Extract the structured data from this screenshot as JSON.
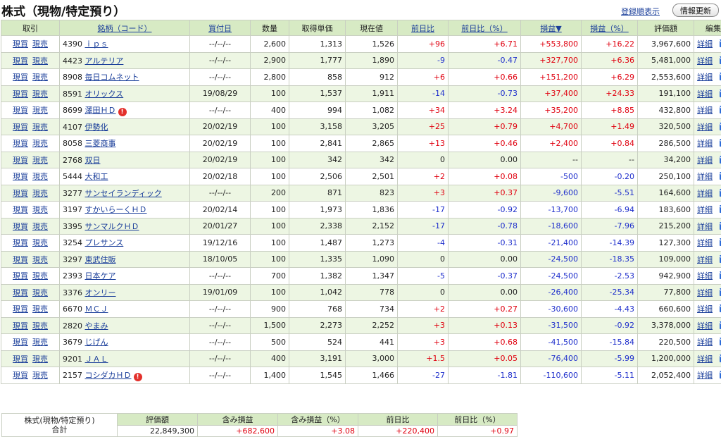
{
  "page": {
    "title": "株式（現物/特定預り）",
    "sort_link": "登録順表示",
    "refresh_button": "情報更新"
  },
  "colors": {
    "header_bg": "#d7eac4",
    "row_alt_bg": "#edf6e3",
    "positive": "#e0000f",
    "negative": "#1f2fcc",
    "link": "#1a3e9a"
  },
  "table": {
    "headers": {
      "torihiki": "取引",
      "meigara": "銘柄（コード）",
      "kaitsukebi": "買付日",
      "suryo": "数量",
      "tanka": "取得単価",
      "genzaine": "現在値",
      "zenjitsuhi": "前日比",
      "zenjitsuhi_pct": "前日比（%）",
      "soneki": "損益▼",
      "soneki_pct": "損益（%）",
      "hyokagaku": "評価額",
      "henshu": "編集"
    },
    "buy_label": "現買",
    "sell_label": "現売",
    "detail_label": "詳細",
    "rows": [
      {
        "code": "4390",
        "name": "ｉｐｓ",
        "date": "--/--/--",
        "qty": "2,600",
        "cost": "1,313",
        "price": "1,526",
        "chg": "+96",
        "chg_pct": "+6.71",
        "pl": "+553,800",
        "pl_pct": "+16.22",
        "value": "3,967,600",
        "warn": false,
        "chg_s": "pos",
        "pct_s": "pos",
        "pl_s": "pos",
        "plp_s": "pos"
      },
      {
        "code": "4423",
        "name": "アルテリア",
        "date": "--/--/--",
        "qty": "2,900",
        "cost": "1,777",
        "price": "1,890",
        "chg": "-9",
        "chg_pct": "-0.47",
        "pl": "+327,700",
        "pl_pct": "+6.36",
        "value": "5,481,000",
        "warn": false,
        "chg_s": "neg",
        "pct_s": "neg",
        "pl_s": "pos",
        "plp_s": "pos"
      },
      {
        "code": "8908",
        "name": "毎日コムネット",
        "date": "--/--/--",
        "qty": "2,800",
        "cost": "858",
        "price": "912",
        "chg": "+6",
        "chg_pct": "+0.66",
        "pl": "+151,200",
        "pl_pct": "+6.29",
        "value": "2,553,600",
        "warn": false,
        "chg_s": "pos",
        "pct_s": "pos",
        "pl_s": "pos",
        "plp_s": "pos"
      },
      {
        "code": "8591",
        "name": "オリックス",
        "date": "19/08/29",
        "qty": "100",
        "cost": "1,537",
        "price": "1,911",
        "chg": "-14",
        "chg_pct": "-0.73",
        "pl": "+37,400",
        "pl_pct": "+24.33",
        "value": "191,100",
        "warn": false,
        "chg_s": "neg",
        "pct_s": "neg",
        "pl_s": "pos",
        "plp_s": "pos"
      },
      {
        "code": "8699",
        "name": "澤田ＨＤ",
        "date": "--/--/--",
        "qty": "400",
        "cost": "994",
        "price": "1,082",
        "chg": "+34",
        "chg_pct": "+3.24",
        "pl": "+35,200",
        "pl_pct": "+8.85",
        "value": "432,800",
        "warn": true,
        "chg_s": "pos",
        "pct_s": "pos",
        "pl_s": "pos",
        "plp_s": "pos"
      },
      {
        "code": "4107",
        "name": "伊勢化",
        "date": "20/02/19",
        "qty": "100",
        "cost": "3,158",
        "price": "3,205",
        "chg": "+25",
        "chg_pct": "+0.79",
        "pl": "+4,700",
        "pl_pct": "+1.49",
        "value": "320,500",
        "warn": false,
        "chg_s": "pos",
        "pct_s": "pos",
        "pl_s": "pos",
        "plp_s": "pos"
      },
      {
        "code": "8058",
        "name": "三菱商事",
        "date": "20/02/19",
        "qty": "100",
        "cost": "2,841",
        "price": "2,865",
        "chg": "+13",
        "chg_pct": "+0.46",
        "pl": "+2,400",
        "pl_pct": "+0.84",
        "value": "286,500",
        "warn": false,
        "chg_s": "pos",
        "pct_s": "pos",
        "pl_s": "pos",
        "plp_s": "pos"
      },
      {
        "code": "2768",
        "name": "双日",
        "date": "20/02/19",
        "qty": "100",
        "cost": "342",
        "price": "342",
        "chg": "0",
        "chg_pct": "0.00",
        "pl": "--",
        "pl_pct": "--",
        "value": "34,200",
        "warn": false,
        "chg_s": "",
        "pct_s": "",
        "pl_s": "",
        "plp_s": ""
      },
      {
        "code": "5444",
        "name": "大和工",
        "date": "20/02/18",
        "qty": "100",
        "cost": "2,506",
        "price": "2,501",
        "chg": "+2",
        "chg_pct": "+0.08",
        "pl": "-500",
        "pl_pct": "-0.20",
        "value": "250,100",
        "warn": false,
        "chg_s": "pos",
        "pct_s": "pos",
        "pl_s": "neg",
        "plp_s": "neg"
      },
      {
        "code": "3277",
        "name": "サンセイランディック",
        "date": "--/--/--",
        "qty": "200",
        "cost": "871",
        "price": "823",
        "chg": "+3",
        "chg_pct": "+0.37",
        "pl": "-9,600",
        "pl_pct": "-5.51",
        "value": "164,600",
        "warn": false,
        "chg_s": "pos",
        "pct_s": "pos",
        "pl_s": "neg",
        "plp_s": "neg"
      },
      {
        "code": "3197",
        "name": "すかいらーくＨＤ",
        "date": "20/02/14",
        "qty": "100",
        "cost": "1,973",
        "price": "1,836",
        "chg": "-17",
        "chg_pct": "-0.92",
        "pl": "-13,700",
        "pl_pct": "-6.94",
        "value": "183,600",
        "warn": false,
        "chg_s": "neg",
        "pct_s": "neg",
        "pl_s": "neg",
        "plp_s": "neg"
      },
      {
        "code": "3395",
        "name": "サンマルクＨＤ",
        "date": "20/01/27",
        "qty": "100",
        "cost": "2,338",
        "price": "2,152",
        "chg": "-17",
        "chg_pct": "-0.78",
        "pl": "-18,600",
        "pl_pct": "-7.96",
        "value": "215,200",
        "warn": false,
        "chg_s": "neg",
        "pct_s": "neg",
        "pl_s": "neg",
        "plp_s": "neg"
      },
      {
        "code": "3254",
        "name": "プレサンス",
        "date": "19/12/16",
        "qty": "100",
        "cost": "1,487",
        "price": "1,273",
        "chg": "-4",
        "chg_pct": "-0.31",
        "pl": "-21,400",
        "pl_pct": "-14.39",
        "value": "127,300",
        "warn": false,
        "chg_s": "neg",
        "pct_s": "neg",
        "pl_s": "neg",
        "plp_s": "neg"
      },
      {
        "code": "3297",
        "name": "東武住販",
        "date": "18/10/05",
        "qty": "100",
        "cost": "1,335",
        "price": "1,090",
        "chg": "0",
        "chg_pct": "0.00",
        "pl": "-24,500",
        "pl_pct": "-18.35",
        "value": "109,000",
        "warn": false,
        "chg_s": "",
        "pct_s": "",
        "pl_s": "neg",
        "plp_s": "neg"
      },
      {
        "code": "2393",
        "name": "日本ケア",
        "date": "--/--/--",
        "qty": "700",
        "cost": "1,382",
        "price": "1,347",
        "chg": "-5",
        "chg_pct": "-0.37",
        "pl": "-24,500",
        "pl_pct": "-2.53",
        "value": "942,900",
        "warn": false,
        "chg_s": "neg",
        "pct_s": "neg",
        "pl_s": "neg",
        "plp_s": "neg"
      },
      {
        "code": "3376",
        "name": "オンリー",
        "date": "19/01/09",
        "qty": "100",
        "cost": "1,042",
        "price": "778",
        "chg": "0",
        "chg_pct": "0.00",
        "pl": "-26,400",
        "pl_pct": "-25.34",
        "value": "77,800",
        "warn": false,
        "chg_s": "",
        "pct_s": "",
        "pl_s": "neg",
        "plp_s": "neg"
      },
      {
        "code": "6670",
        "name": "ＭＣＪ",
        "date": "--/--/--",
        "qty": "900",
        "cost": "768",
        "price": "734",
        "chg": "+2",
        "chg_pct": "+0.27",
        "pl": "-30,600",
        "pl_pct": "-4.43",
        "value": "660,600",
        "warn": false,
        "chg_s": "pos",
        "pct_s": "pos",
        "pl_s": "neg",
        "plp_s": "neg"
      },
      {
        "code": "2820",
        "name": "やまみ",
        "date": "--/--/--",
        "qty": "1,500",
        "cost": "2,273",
        "price": "2,252",
        "chg": "+3",
        "chg_pct": "+0.13",
        "pl": "-31,500",
        "pl_pct": "-0.92",
        "value": "3,378,000",
        "warn": false,
        "chg_s": "pos",
        "pct_s": "pos",
        "pl_s": "neg",
        "plp_s": "neg"
      },
      {
        "code": "3679",
        "name": "じげん",
        "date": "--/--/--",
        "qty": "500",
        "cost": "524",
        "price": "441",
        "chg": "+3",
        "chg_pct": "+0.68",
        "pl": "-41,500",
        "pl_pct": "-15.84",
        "value": "220,500",
        "warn": false,
        "chg_s": "pos",
        "pct_s": "pos",
        "pl_s": "neg",
        "plp_s": "neg"
      },
      {
        "code": "9201",
        "name": "ＪＡＬ",
        "date": "--/--/--",
        "qty": "400",
        "cost": "3,191",
        "price": "3,000",
        "chg": "+1.5",
        "chg_pct": "+0.05",
        "pl": "-76,400",
        "pl_pct": "-5.99",
        "value": "1,200,000",
        "warn": false,
        "chg_s": "pos",
        "pct_s": "pos",
        "pl_s": "neg",
        "plp_s": "neg"
      },
      {
        "code": "2157",
        "name": "コシダカＨＤ",
        "date": "--/--/--",
        "qty": "1,400",
        "cost": "1,545",
        "price": "1,466",
        "chg": "-27",
        "chg_pct": "-1.81",
        "pl": "-110,600",
        "pl_pct": "-5.11",
        "value": "2,052,400",
        "warn": true,
        "chg_s": "neg",
        "pct_s": "neg",
        "pl_s": "neg",
        "plp_s": "neg"
      }
    ]
  },
  "summary": {
    "label_line1": "株式(現物/特定預り)",
    "label_line2": "合計",
    "headers": [
      "評価額",
      "含み損益",
      "含み損益（%）",
      "前日比",
      "前日比（%）"
    ],
    "values": [
      "22,849,300",
      "+682,600",
      "+3.08",
      "+220,400",
      "+0.97"
    ],
    "styles": [
      "",
      "pos",
      "pos",
      "pos",
      "pos"
    ]
  }
}
